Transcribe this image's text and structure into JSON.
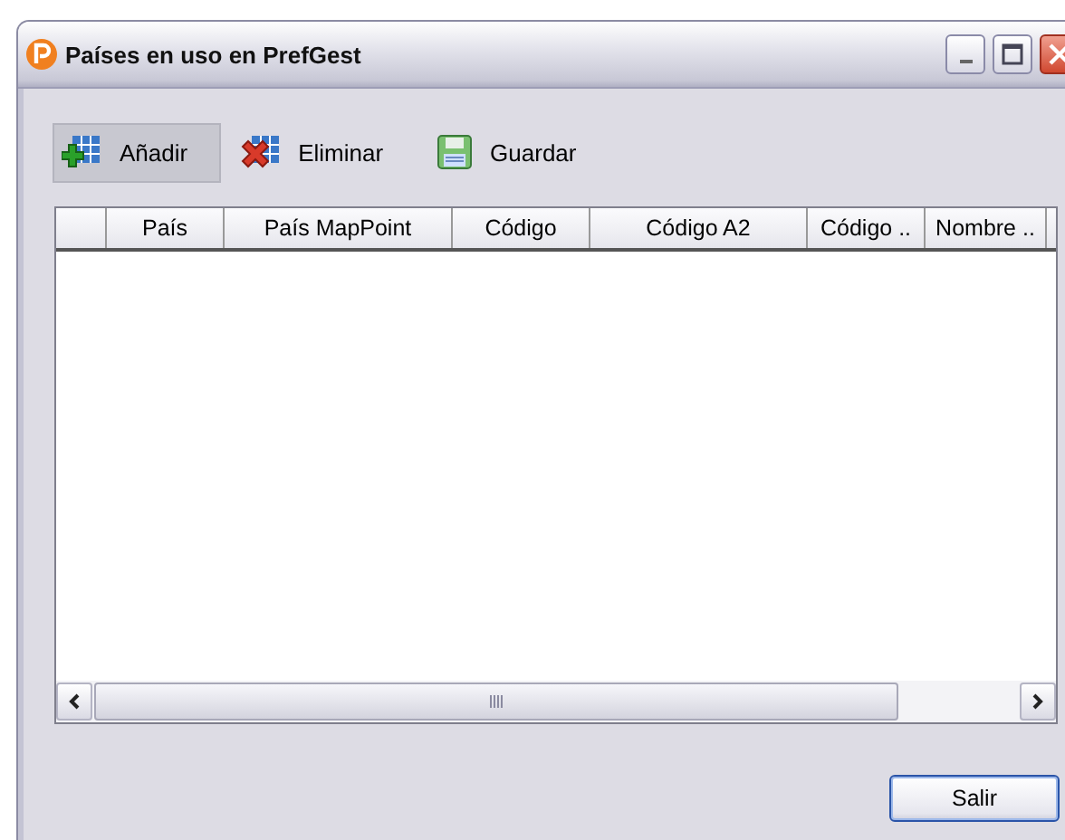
{
  "window": {
    "title": "Países en uso en PrefGest"
  },
  "toolbar": [
    {
      "kind": "add",
      "label": "Añadir",
      "hot": true
    },
    {
      "kind": "delete",
      "label": "Eliminar",
      "hot": false
    },
    {
      "kind": "save",
      "label": "Guardar",
      "hot": false
    }
  ],
  "table": {
    "columns": [
      "País",
      "País MapPoint",
      "Código",
      "Código A2",
      "Código ..",
      "Nombre .."
    ]
  },
  "buttons": [
    {
      "label": "Salir",
      "default": true
    }
  ]
}
